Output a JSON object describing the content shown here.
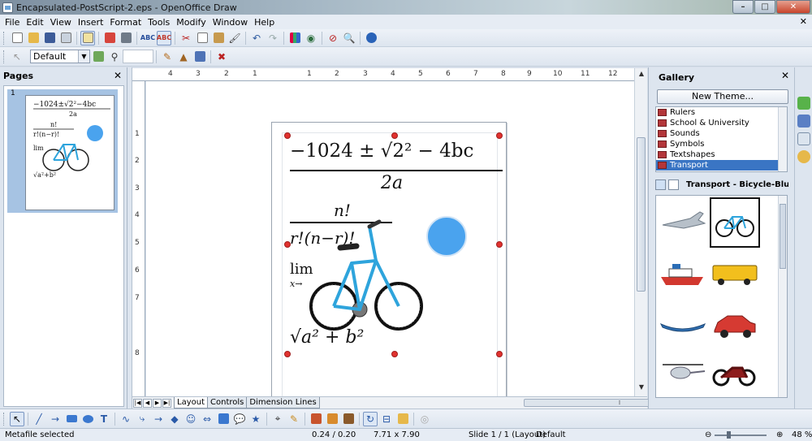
{
  "window": {
    "title": "Encapsulated-PostScript-2.eps - OpenOffice Draw"
  },
  "menu": {
    "items": [
      "File",
      "Edit",
      "View",
      "Insert",
      "Format",
      "Tools",
      "Modify",
      "Window",
      "Help"
    ]
  },
  "toolbar2": {
    "style_value": "Default"
  },
  "pages_panel": {
    "title": "Pages",
    "thumb_number": "1"
  },
  "ruler": {
    "h_ticks": [
      "4",
      "3",
      "2",
      "1",
      "1",
      "2",
      "3",
      "4",
      "5",
      "6",
      "7",
      "8",
      "9",
      "10",
      "11",
      "12"
    ],
    "v_ticks": [
      "1",
      "2",
      "3",
      "4",
      "5",
      "6",
      "7",
      "8"
    ]
  },
  "slide": {
    "formula1_num": "−1024 ± √2² − 4bc",
    "formula1_den": "2a",
    "formula2_num": "n!",
    "formula2_den": "r!(n−r)!",
    "formula3": "lim",
    "formula3_sub": "x→",
    "formula4": "√a² + b²"
  },
  "tabs": [
    "Layout",
    "Controls",
    "Dimension Lines"
  ],
  "gallery": {
    "title": "Gallery",
    "new_theme_label": "New Theme...",
    "themes": [
      "Rulers",
      "School & University",
      "Sounds",
      "Symbols",
      "Textshapes",
      "Transport"
    ],
    "selected_theme": "Transport",
    "selected_item": "Transport - Bicycle-Blue (C:\\P"
  },
  "status": {
    "message": "Metafile selected",
    "position": "0.24 / 0.20",
    "size": "7.71 x 7.90",
    "slide": "Slide 1 / 1 (Layout)",
    "layout": "Default",
    "zoom": "48 %"
  },
  "colors": {
    "accent": "#3a75c4",
    "handle": "#e1322f",
    "bike_frame": "#2ea4dc"
  }
}
